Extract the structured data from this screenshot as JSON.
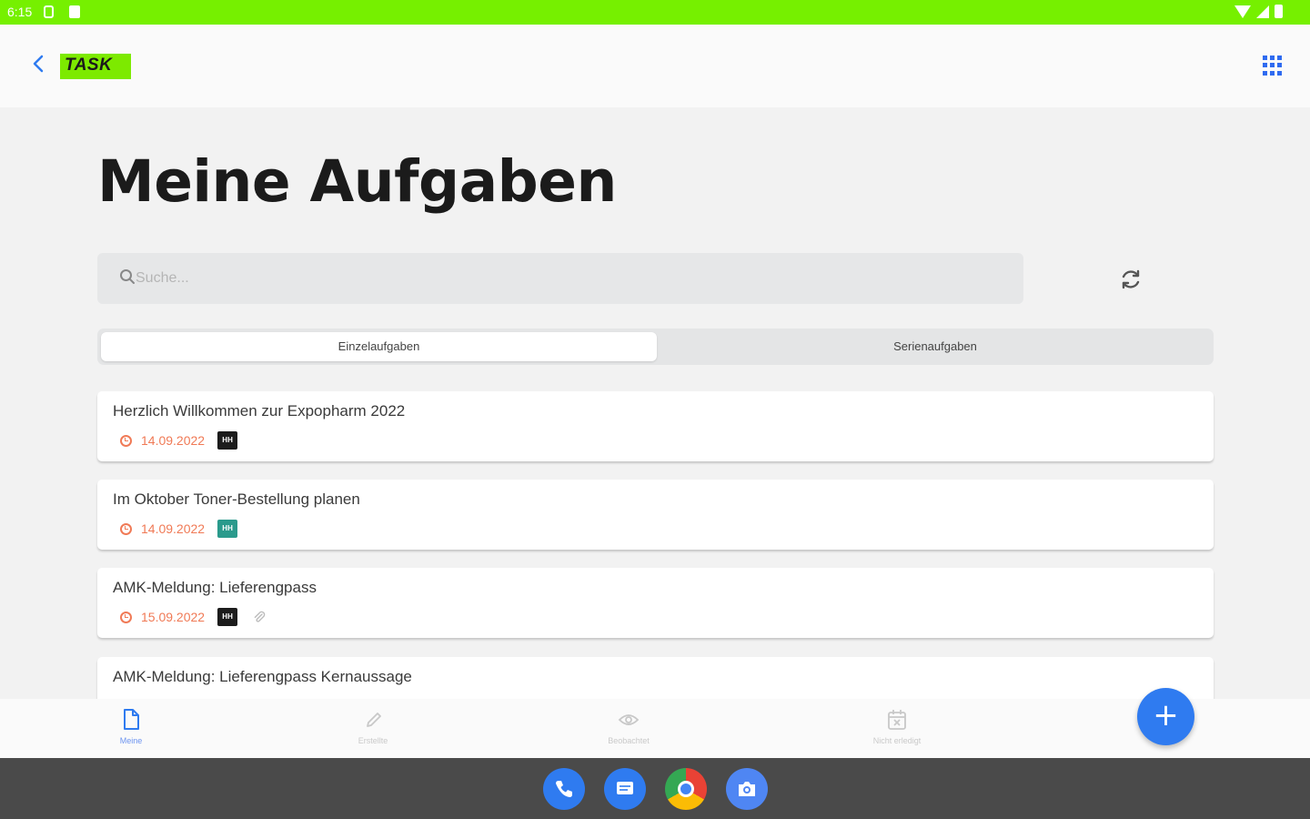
{
  "status_bar": {
    "time": "6:15",
    "color": "#76f000"
  },
  "header": {
    "logo_text": "TASK",
    "logo_color": "#7dea00",
    "back_icon": "chevron-left-icon",
    "apps_icon": "apps-grid-icon"
  },
  "main": {
    "title": "Meine Aufgaben",
    "search": {
      "placeholder": "Suche...",
      "value": ""
    },
    "tabs": [
      {
        "label": "Einzelaufgaben",
        "active": true
      },
      {
        "label": "Serienaufgaben",
        "active": false
      }
    ],
    "tasks": [
      {
        "title": "Herzlich Willkommen zur Expopharm 2022",
        "date": "14.09.2022",
        "assignee": "HH",
        "assignee_color": "#1c1c1c",
        "has_attachment": false
      },
      {
        "title": "Im Oktober Toner-Bestellung planen",
        "date": "14.09.2022",
        "assignee": "HH",
        "assignee_color": "#2a9a8c",
        "has_attachment": false
      },
      {
        "title": "AMK-Meldung: Lieferengpass",
        "date": "15.09.2022",
        "assignee": "HH",
        "assignee_color": "#1c1c1c",
        "has_attachment": true
      },
      {
        "title": "AMK-Meldung: Lieferengpass Kernaussage",
        "date": "",
        "assignee": "",
        "has_attachment": false
      }
    ]
  },
  "bottom_nav": {
    "items": [
      {
        "label": "Meine",
        "icon": "document-icon",
        "active": true
      },
      {
        "label": "Erstellte",
        "icon": "pencil-icon",
        "active": false
      },
      {
        "label": "Beobachtet",
        "icon": "eye-icon",
        "active": false
      },
      {
        "label": "Nicht erledigt",
        "icon": "calendar-x-icon",
        "active": false
      }
    ],
    "fab_label": "+"
  },
  "dock": {
    "apps": [
      "phone",
      "messages",
      "chrome",
      "camera"
    ]
  },
  "colors": {
    "accent": "#2f7bf0",
    "date": "#f07a56",
    "brand_green": "#76f000"
  }
}
